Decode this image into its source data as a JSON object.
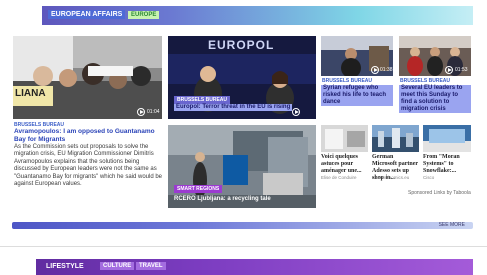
{
  "header": {
    "title": "EUROPEAN AFFAIRS",
    "tag": "EUROPE"
  },
  "lead": {
    "duration": "01:04",
    "category": "BRUSSELS BUREAU",
    "title": "Avramopoulos: I am opposed to Guantanamo Bay for Migrants",
    "body": "As the Commission sets out proposals to solve the migration crisis, EU Migration Commissioner Dimitris Avramopoulos explains that the solutions being discussed by European leaders were not the same as \"Guantanamo Bay for migrants\" which he said would be against European values.",
    "banner_text": "LIANA"
  },
  "center_top": {
    "category": "BRUSSELS BUREAU",
    "caption": "Europol: Terror threat in the EU is rising",
    "screen_text": "EUROPOL"
  },
  "center_bottom": {
    "category": "SMART REGIONS",
    "caption": "RCERO Ljubljana: a recycling tale"
  },
  "right_top": [
    {
      "duration": "01:38",
      "category": "BRUSSELS BUREAU",
      "caption": "Syrian refugee who risked his life to teach dance"
    },
    {
      "duration": "01:53",
      "category": "BRUSSELS BUREAU",
      "caption": "Several EU leaders to meet this Sunday to find a solution to migration crisis"
    }
  ],
  "sponsored": [
    {
      "title": "Voici quelques astuces pour aménager une...",
      "source": "Elise de Conduire"
    },
    {
      "title": "German Microsoft partner Adesso sets up shop in...",
      "source": "Channelnomics.eu"
    },
    {
      "title": "From \"Moran Systems\" to Snowflake:...",
      "source": "Cisco"
    }
  ],
  "sponsored_note": "Sponsored Links by Taboola",
  "see_more": "SEE MORE",
  "lifestyle": {
    "title": "LIFESTYLE",
    "tags": [
      "CULTURE",
      "TRAVEL"
    ]
  },
  "colors": {
    "accent": "#6a66cf",
    "highlight": "#9aa4f0",
    "smart": "#9b3bd1"
  }
}
